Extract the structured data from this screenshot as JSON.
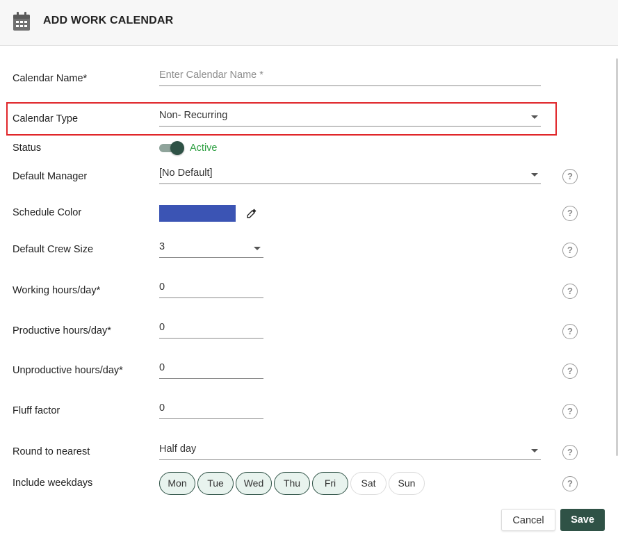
{
  "header": {
    "title": "ADD WORK CALENDAR",
    "icon": "calendar-icon"
  },
  "form": {
    "calendar_name": {
      "label": "Calendar Name*",
      "value": "",
      "placeholder": "Enter Calendar Name *"
    },
    "calendar_type": {
      "label": "Calendar Type",
      "value": "Non- Recurring"
    },
    "status": {
      "label": "Status",
      "value": "Active",
      "enabled": true
    },
    "default_manager": {
      "label": "Default Manager",
      "value": "[No Default]"
    },
    "schedule_color": {
      "label": "Schedule Color",
      "value": "#3b54b4"
    },
    "default_crew_size": {
      "label": "Default Crew Size",
      "value": "3"
    },
    "working_hours": {
      "label": "Working hours/day*",
      "value": "0"
    },
    "productive_hours": {
      "label": "Productive hours/day*",
      "value": "0"
    },
    "unproductive_hours": {
      "label": "Unproductive hours/day*",
      "value": "0"
    },
    "fluff_factor": {
      "label": "Fluff factor",
      "value": "0"
    },
    "round_to_nearest": {
      "label": "Round to nearest",
      "value": "Half day"
    },
    "include_weekdays": {
      "label": "Include weekdays",
      "days": [
        {
          "label": "Mon",
          "selected": true
        },
        {
          "label": "Tue",
          "selected": true
        },
        {
          "label": "Wed",
          "selected": true
        },
        {
          "label": "Thu",
          "selected": true
        },
        {
          "label": "Fri",
          "selected": true
        },
        {
          "label": "Sat",
          "selected": false
        },
        {
          "label": "Sun",
          "selected": false
        }
      ]
    },
    "help_glyph": "?"
  },
  "actions": {
    "cancel_label": "Cancel",
    "save_label": "Save"
  },
  "colors": {
    "accent": "#2f5246",
    "active_status": "#2ea042",
    "highlight_border": "#e0262a"
  }
}
